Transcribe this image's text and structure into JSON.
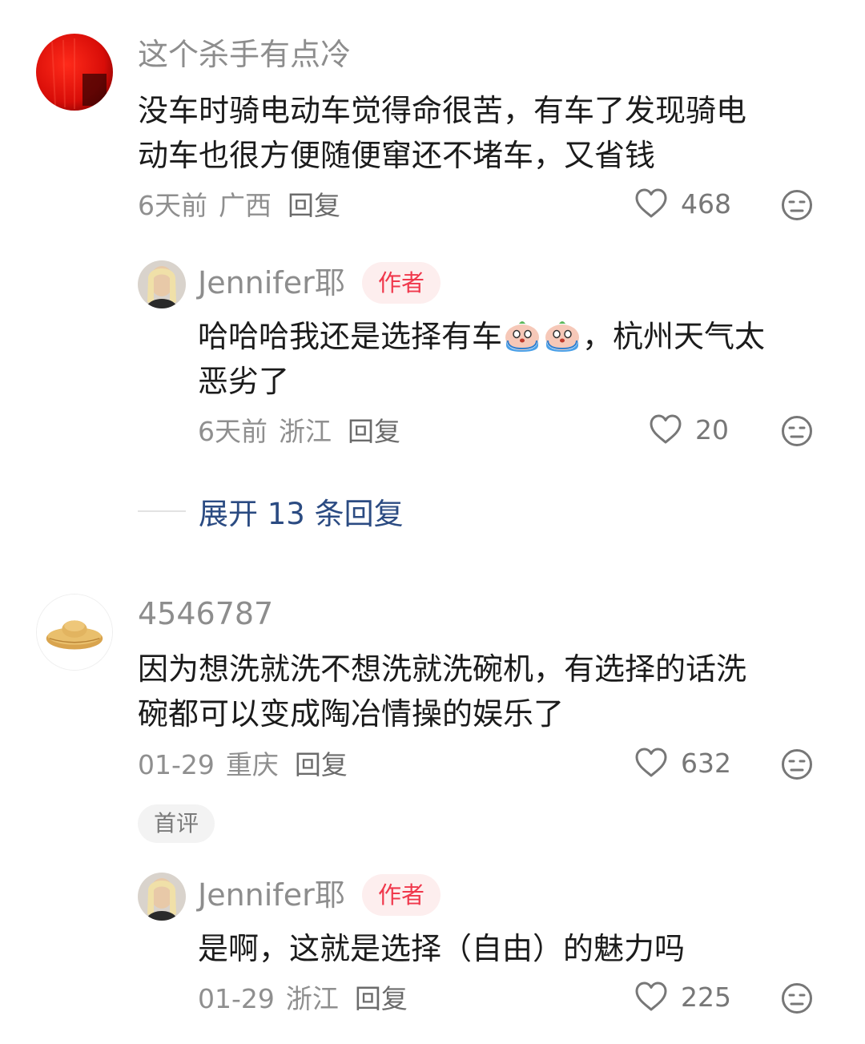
{
  "comments": [
    {
      "username": "这个杀手有点冷",
      "text_line1": "没车时骑电动车觉得命很苦，有车了发现骑电",
      "text_line2": "动车也很方便随便窜还不堵车，又省钱",
      "time": "6天前",
      "location": "广西",
      "reply_label": "回复",
      "likes": "468",
      "reply": {
        "username": "Jennifer耶",
        "badge": "作者",
        "text_before_emoji": "哈哈哈我还是选择有车",
        "text_after_emoji": "，杭州天气太",
        "text_line2": "恶劣了",
        "time": "6天前",
        "location": "浙江",
        "reply_label": "回复",
        "likes": "20"
      },
      "expand_label": "展开 13 条回复"
    },
    {
      "username": "4546787",
      "text_line1": "因为想洗就洗不想洗就洗碗机，有选择的话洗",
      "text_line2": "碗都可以变成陶冶情操的娱乐了",
      "time": "01-29",
      "location": "重庆",
      "reply_label": "回复",
      "likes": "632",
      "tag": "首评",
      "reply": {
        "username": "Jennifer耶",
        "badge": "作者",
        "text": "是啊，这就是选择（自由）的魅力吗",
        "time": "01-29",
        "location": "浙江",
        "reply_label": "回复",
        "likes": "225"
      }
    }
  ],
  "icons": {
    "like": "heart-outline-icon",
    "dislike": "meh-face-icon",
    "emoji": "crying-face-emoji"
  },
  "colors": {
    "username": "#8d8d8d",
    "badge_text": "#f0384c",
    "badge_bg": "#fdeeee",
    "expand_link": "#2b4b82"
  }
}
